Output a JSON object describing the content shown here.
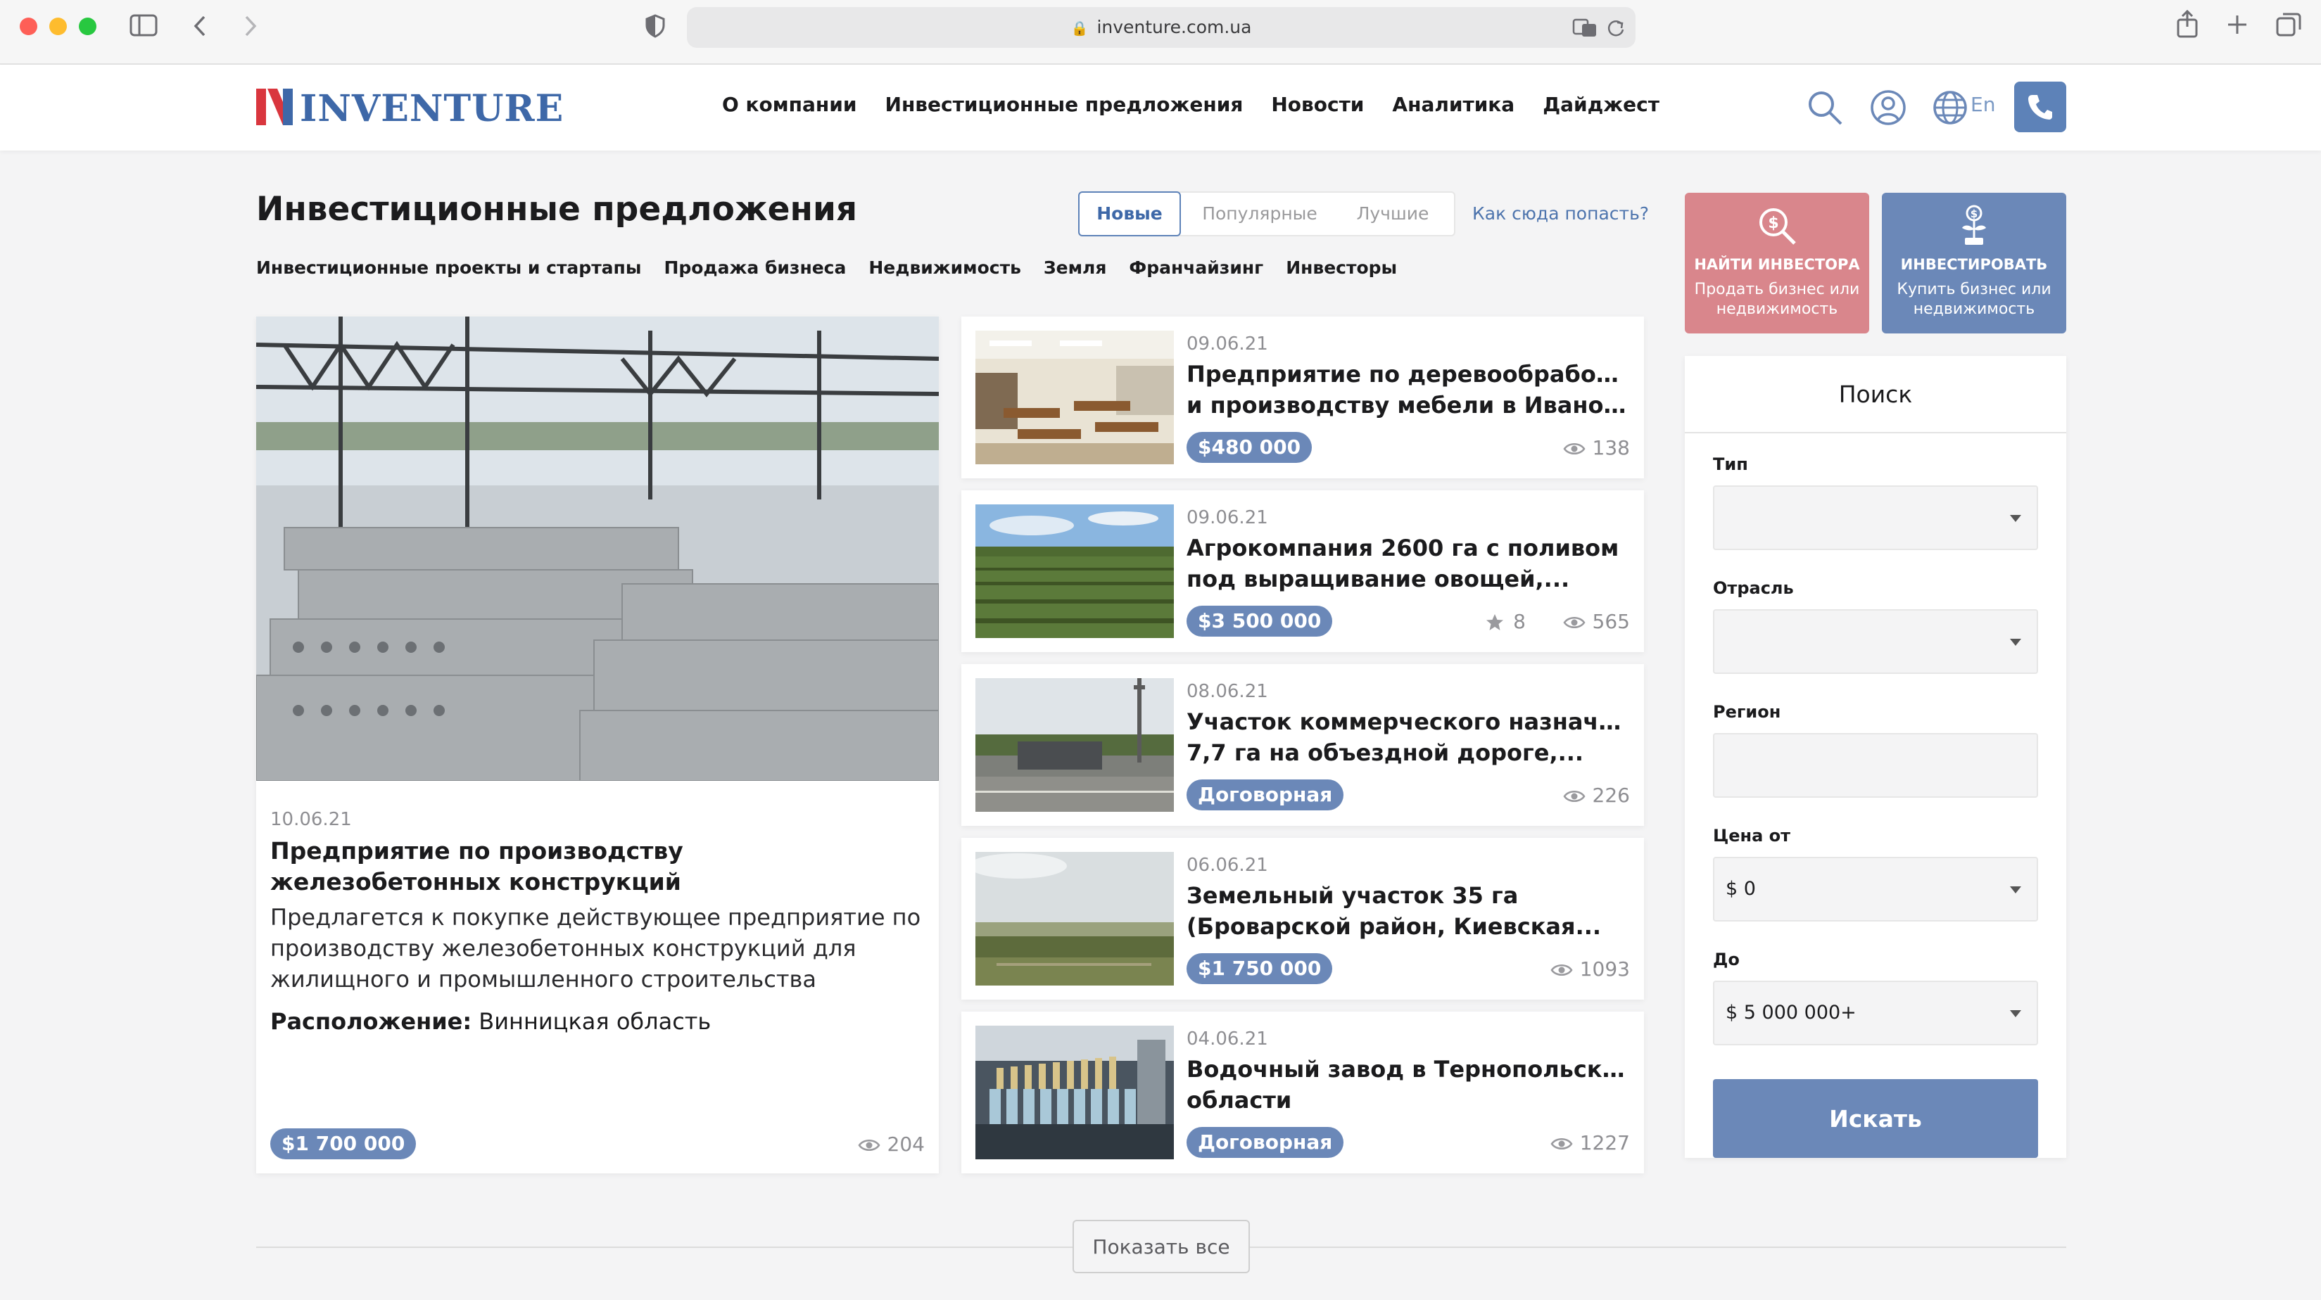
{
  "browser": {
    "url": "inventure.com.ua"
  },
  "header": {
    "logo_text": "INVENTURE",
    "nav": [
      {
        "label": "О компании"
      },
      {
        "label": "Инвестиционные предложения"
      },
      {
        "label": "Новости"
      },
      {
        "label": "Аналитика"
      },
      {
        "label": "Дайджест"
      }
    ],
    "lang": "En"
  },
  "page": {
    "title": "Инвестиционные предложения",
    "sort_tabs": [
      "Новые",
      "Популярные",
      "Лучшие"
    ],
    "active_sort": "Новые",
    "how_link": "Как сюда попасть?",
    "categories": [
      "Инвестиционные проекты и стартапы",
      "Продажа бизнеса",
      "Недвижимость",
      "Земля",
      "Франчайзинг",
      "Инвесторы"
    ]
  },
  "featured": {
    "date": "10.06.21",
    "title": "Предприятие по производству железобетонных конструкций",
    "description": "Предлагется к покупке действующее предприятие по производству железобетонных конструкций для жилищного и промышленного строительства",
    "location_label": "Расположение:",
    "location": "Винницкая область",
    "price": "$1 700 000",
    "views": "204"
  },
  "listings": [
    {
      "date": "09.06.21",
      "title_line1": "Предприятие по деревообработке",
      "title_line2": "и производству мебели в Ивано-...",
      "price": "$480 000",
      "views": "138",
      "stars": ""
    },
    {
      "date": "09.06.21",
      "title_line1": "Агрокомпания 2600 га с поливом",
      "title_line2": "под выращивание овощей,...",
      "price": "$3 500 000",
      "views": "565",
      "stars": "8"
    },
    {
      "date": "08.06.21",
      "title_line1": "Участок коммерческого назначения",
      "title_line2": "7,7 га на объездной дороге,...",
      "price": "Договорная",
      "views": "226",
      "stars": ""
    },
    {
      "date": "06.06.21",
      "title_line1": "Земельный участок 35 га",
      "title_line2": "(Броварской район, Киевская...",
      "price": "$1 750 000",
      "views": "1093",
      "stars": ""
    },
    {
      "date": "04.06.21",
      "title_line1": "Водочный завод в Тернопольской",
      "title_line2": "области",
      "price": "Договорная",
      "views": "1227",
      "stars": ""
    }
  ],
  "sidebar": {
    "find_investor": {
      "title": "НАЙТИ ИНВЕСТОРА",
      "subtitle": "Продать бизнес или недвижимость"
    },
    "invest": {
      "title": "ИНВЕСТИРОВАТЬ",
      "subtitle": "Купить бизнес или недвижимость"
    },
    "search": {
      "title": "Поиск",
      "type_label": "Тип",
      "type_value": "",
      "industry_label": "Отрасль",
      "industry_value": "",
      "region_label": "Регион",
      "region_value": "",
      "price_from_label": "Цена от",
      "price_from_value": "$ 0",
      "price_to_label": "До",
      "price_to_value": "$ 5 000 000+",
      "button": "Искать"
    }
  },
  "show_all": "Показать все",
  "colors": {
    "accent": "#6b88b8",
    "brand_blue": "#3e68a8",
    "brand_red": "#d9363e",
    "cta_red": "#d9868c"
  }
}
